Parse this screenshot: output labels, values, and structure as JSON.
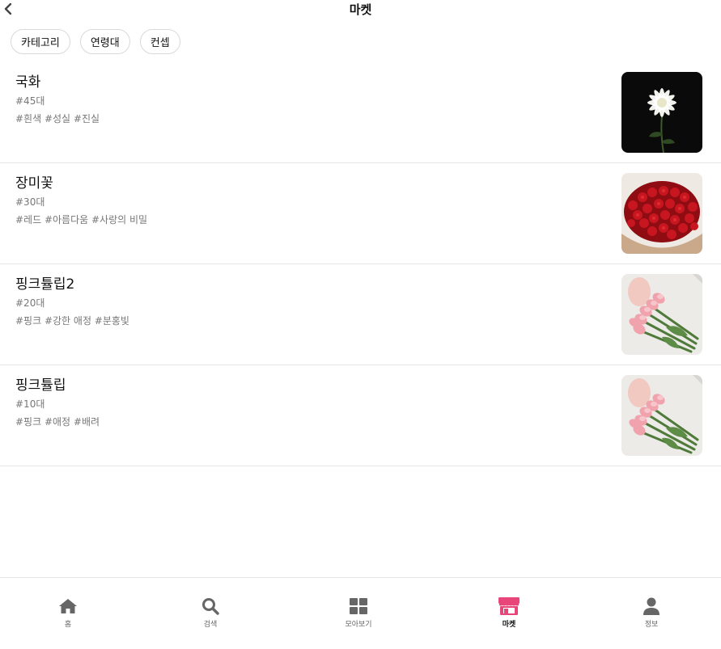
{
  "header": {
    "title": "마켓",
    "back_icon": "chevron-left-icon"
  },
  "filters": [
    {
      "label": "카테고리"
    },
    {
      "label": "연령대"
    },
    {
      "label": "컨셉"
    }
  ],
  "products": [
    {
      "name": "국화",
      "age": "#45대",
      "tags": "#흰색 #성실 #진실",
      "image": "white-chrysanthemum"
    },
    {
      "name": "장미꽃",
      "age": "#30대",
      "tags": "#레드 #아름다움 #사랑의 비밀",
      "image": "red-rose-bouquet"
    },
    {
      "name": "핑크튤립2",
      "age": "#20대",
      "tags": "#핑크 #강한 애정 #분홍빛",
      "image": "pink-tulip-bouquet"
    },
    {
      "name": "핑크튤립",
      "age": "#10대",
      "tags": "#핑크 #애정 #배려",
      "image": "pink-tulip-bouquet"
    }
  ],
  "bottom_nav": {
    "items": [
      {
        "label": "홈",
        "icon": "home-icon",
        "active": false
      },
      {
        "label": "검색",
        "icon": "search-icon",
        "active": false
      },
      {
        "label": "모아보기",
        "icon": "grid-icon",
        "active": false
      },
      {
        "label": "마켓",
        "icon": "store-icon",
        "active": true
      },
      {
        "label": "정보",
        "icon": "user-icon",
        "active": false
      }
    ],
    "active_color": "#e8457a",
    "inactive_color": "#666666"
  }
}
